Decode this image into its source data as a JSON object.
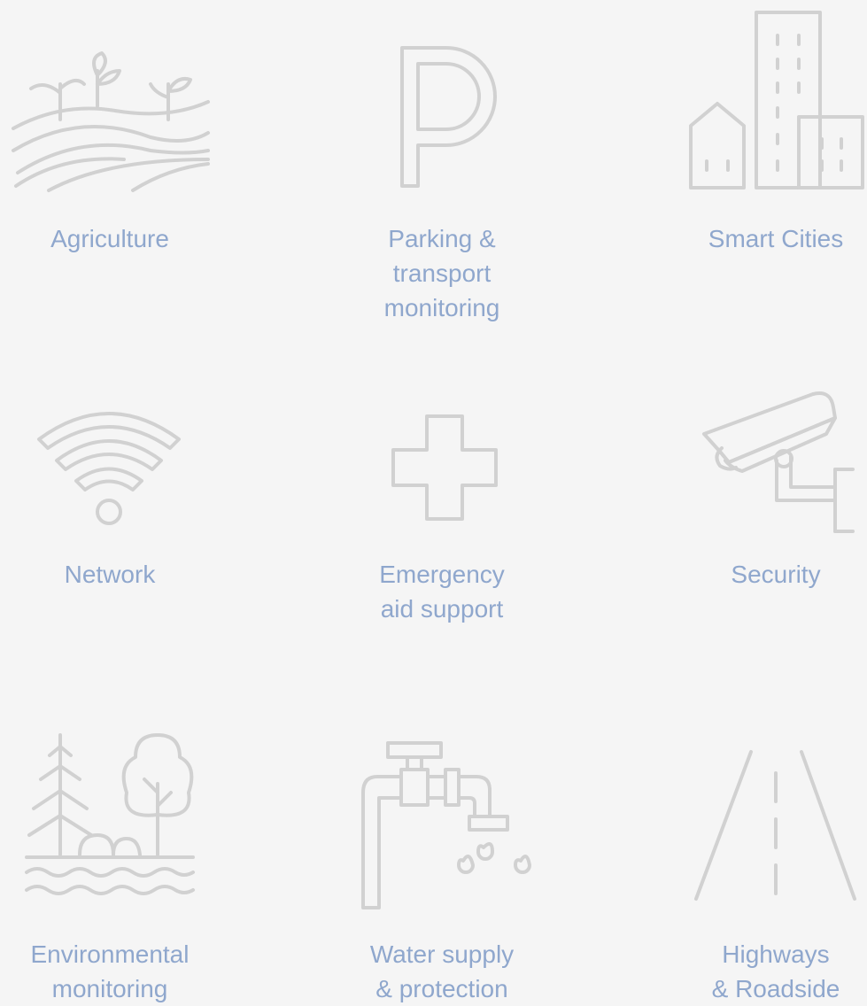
{
  "colors": {
    "background": "#f5f5f5",
    "label": "#8fa7cd",
    "icon_stroke": "#d1d1d1"
  },
  "tiles": [
    {
      "icon": "agriculture-icon",
      "label": "Agriculture"
    },
    {
      "icon": "parking-icon",
      "label": "Parking &\ntransport\nmonitoring"
    },
    {
      "icon": "smart-city-icon",
      "label": "Smart Cities"
    },
    {
      "icon": "wifi-icon",
      "label": "Network"
    },
    {
      "icon": "medical-cross-icon",
      "label": "Emergency\naid support"
    },
    {
      "icon": "security-camera-icon",
      "label": "Security"
    },
    {
      "icon": "nature-icon",
      "label": "Environmental\nmonitoring"
    },
    {
      "icon": "water-tap-icon",
      "label": "Water supply\n& protection"
    },
    {
      "icon": "road-icon",
      "label": "Highways\n& Roadside"
    }
  ]
}
